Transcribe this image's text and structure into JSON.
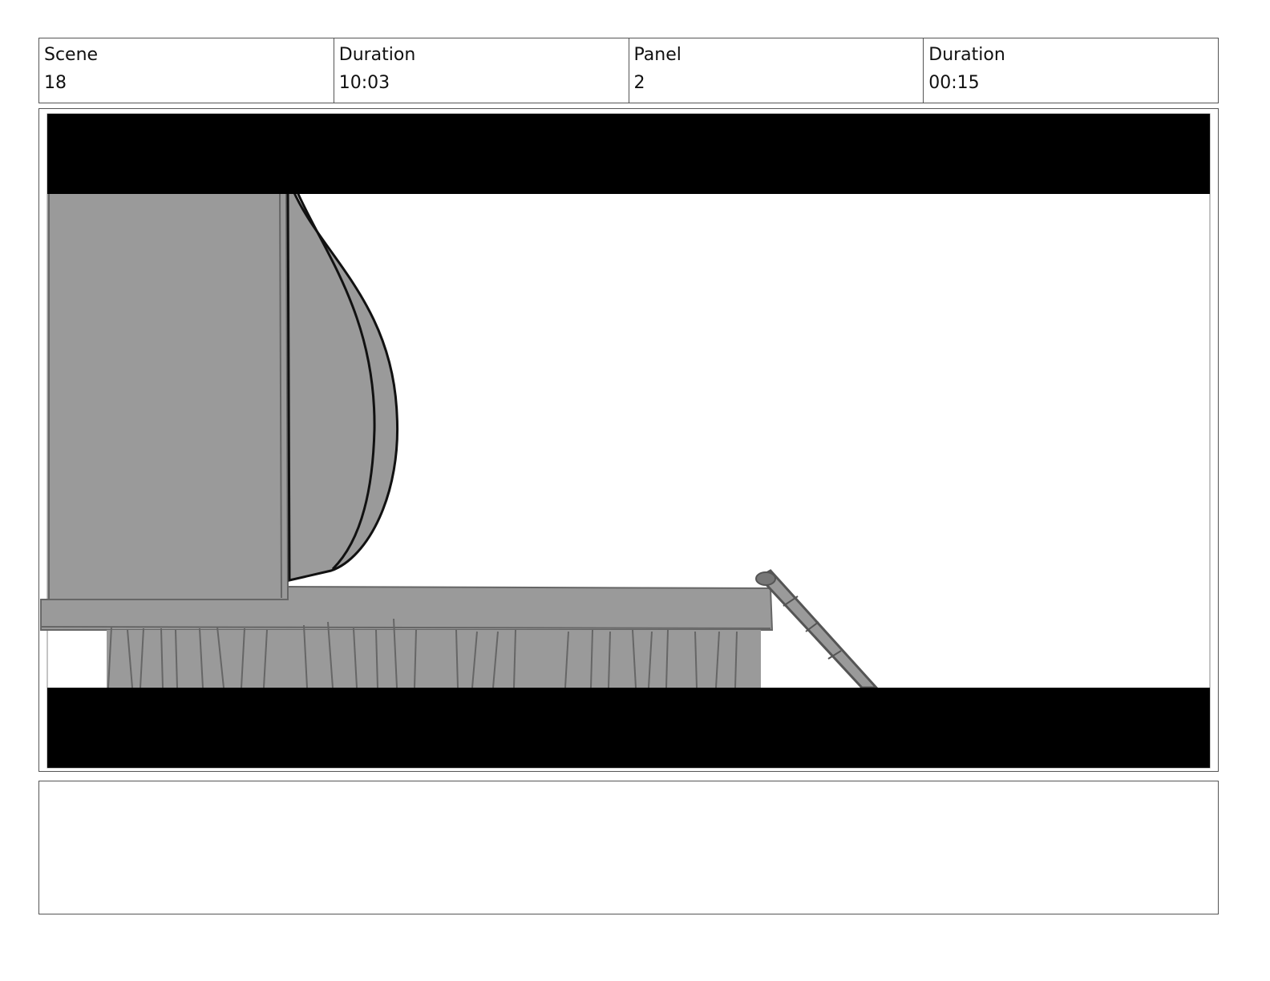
{
  "header": {
    "scene_label": "Scene",
    "scene_value": "18",
    "scene_duration_label": "Duration",
    "scene_duration_value": "10:03",
    "panel_label": "Panel",
    "panel_value": "2",
    "panel_duration_label": "Duration",
    "panel_duration_value": "00:15"
  },
  "notes": {
    "text": ""
  },
  "colors": {
    "border": "#555555",
    "letterbox": "#000000",
    "fill": "#9a9a9a"
  }
}
